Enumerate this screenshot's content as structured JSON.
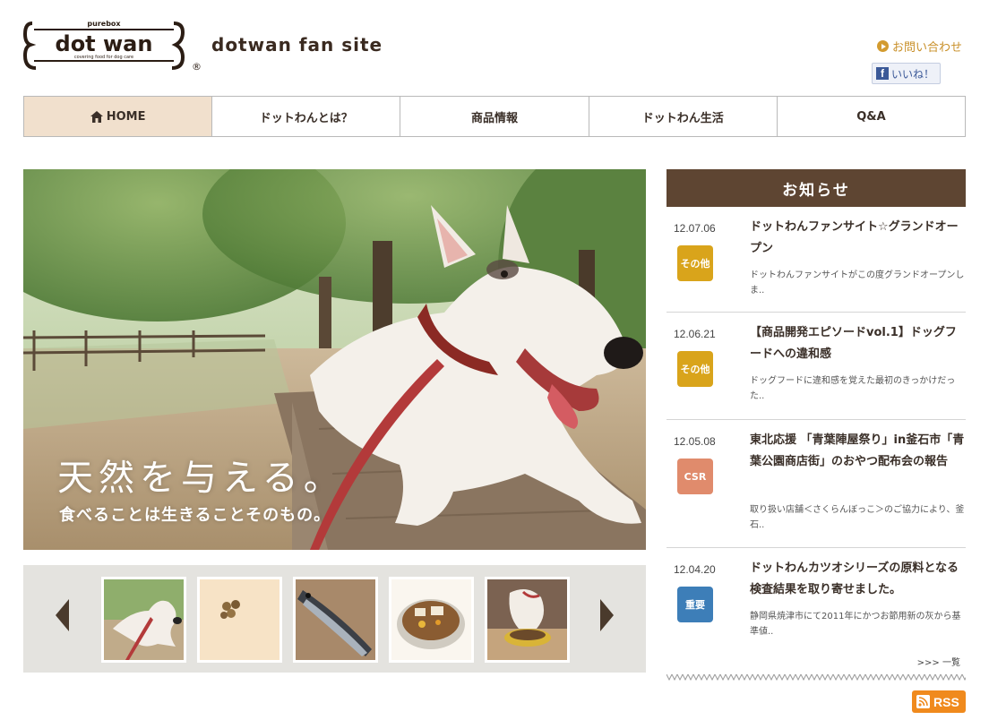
{
  "header": {
    "logo_small": "purebox",
    "logo_main": "dot wan",
    "logo_tagline": "covering food for dog care",
    "logo_mark": "®",
    "site_title": "dotwan fan site",
    "contact_label": "お問い合わせ",
    "like_label": "いいね！"
  },
  "nav": {
    "items": [
      {
        "label": "HOME"
      },
      {
        "label": "ドットわんとは？"
      },
      {
        "label": "商品情報"
      },
      {
        "label": "ドットわん生活"
      },
      {
        "label": "Q&A"
      }
    ]
  },
  "hero": {
    "headline": "天然を与える。",
    "subline": "食べることは生きることそのもの。"
  },
  "thumbnails": {
    "items": [
      {
        "icon": "dog-on-bench-thumb"
      },
      {
        "icon": "dog-food-pellets-thumb"
      },
      {
        "icon": "bonito-fish-thumb"
      },
      {
        "icon": "food-bowl-thumb"
      },
      {
        "icon": "dog-eating-thumb"
      }
    ]
  },
  "news": {
    "header": "お知らせ",
    "items": [
      {
        "date": "12.07.06",
        "badge": "その他",
        "badge_color": "#d9a41b",
        "title": "ドットわんファンサイト☆グランドオープン",
        "desc": "ドットわんファンサイトがこの度グランドオープンしま.."
      },
      {
        "date": "12.06.21",
        "badge": "その他",
        "badge_color": "#d9a41b",
        "title": "【商品開発エピソードvol.1】ドッグフードへの違和感",
        "desc": "ドッグフードに違和感を覚えた最初のきっかけだった.."
      },
      {
        "date": "12.05.08",
        "badge": "CSR",
        "badge_color": "#e08b6c",
        "title": "東北応援 「青葉陣屋祭り」in釜石市「青葉公園商店街」のおやつ配布会の報告",
        "desc": "取り扱い店舗＜さくらんぼっこ＞のご協力により、釜石.."
      },
      {
        "date": "12.04.20",
        "badge": "重要",
        "badge_color": "#3d7eb8",
        "title": "ドットわんカツオシリーズの原料となる検査結果を取り寄せました。",
        "desc": "静岡県焼津市にて2011年にかつお節用新の灰から基準値.."
      }
    ],
    "more_label": ">>> 一覧"
  },
  "footer": {
    "rss_label": "RSS"
  },
  "colors": {
    "nav_active": "#f1e0cd",
    "news_header": "#5e4532",
    "accent_orange": "#c9902a",
    "rss": "#f08a1d"
  }
}
